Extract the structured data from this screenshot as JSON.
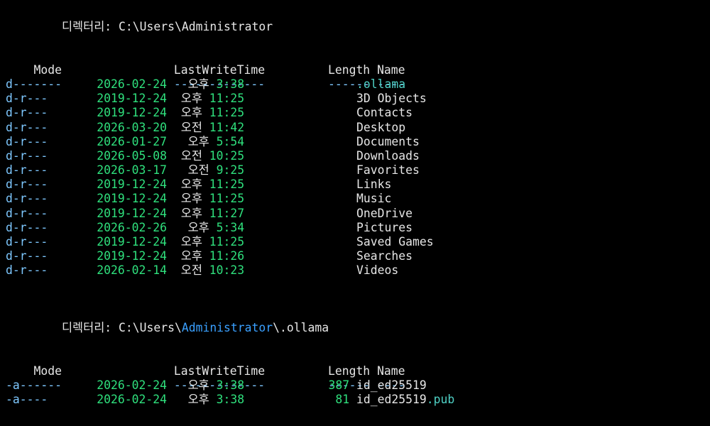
{
  "colors": {
    "background": "#000000",
    "foreground": "#e6e6e6",
    "underline": "#7ec8ff",
    "path_highlight": "#3aa0ff",
    "timestamp": "#2fe07d",
    "file_accent": "#4fd1c5"
  },
  "listings": [
    {
      "dir_label": "디렉터리:",
      "dir_path": "C:\\Users\\Administrator",
      "dir_path_parts": {
        "prefix": "C:\\Users\\",
        "highlight": "",
        "suffix": "Administrator"
      },
      "headers": {
        "mode": "Mode",
        "lastwritetime": "LastWriteTime",
        "length": "Length",
        "name": "Name"
      },
      "underlines": {
        "mode": "----",
        "lastwritetime": "-------------",
        "length": "------",
        "name": "----"
      },
      "rows": [
        {
          "mode": "d-----",
          "date": "2026-02-24",
          "ampm": "오후",
          "time": "3:38",
          "length": "",
          "name": ".ollama",
          "name_accent": true
        },
        {
          "mode": "d-r---",
          "date": "2019-12-24",
          "ampm": "오후",
          "time": "11:25",
          "length": "",
          "name": "3D Objects"
        },
        {
          "mode": "d-r---",
          "date": "2019-12-24",
          "ampm": "오후",
          "time": "11:25",
          "length": "",
          "name": "Contacts"
        },
        {
          "mode": "d-r---",
          "date": "2026-03-20",
          "ampm": "오전",
          "time": "11:42",
          "length": "",
          "name": "Desktop"
        },
        {
          "mode": "d-r---",
          "date": "2026-01-27",
          "ampm": "오후",
          "time": "5:54",
          "length": "",
          "name": "Documents"
        },
        {
          "mode": "d-r---",
          "date": "2026-05-08",
          "ampm": "오전",
          "time": "10:25",
          "length": "",
          "name": "Downloads"
        },
        {
          "mode": "d-r---",
          "date": "2026-03-17",
          "ampm": "오전",
          "time": "9:25",
          "length": "",
          "name": "Favorites"
        },
        {
          "mode": "d-r---",
          "date": "2019-12-24",
          "ampm": "오후",
          "time": "11:25",
          "length": "",
          "name": "Links"
        },
        {
          "mode": "d-r---",
          "date": "2019-12-24",
          "ampm": "오후",
          "time": "11:25",
          "length": "",
          "name": "Music"
        },
        {
          "mode": "d-r---",
          "date": "2019-12-24",
          "ampm": "오후",
          "time": "11:27",
          "length": "",
          "name": "OneDrive"
        },
        {
          "mode": "d-r---",
          "date": "2026-02-26",
          "ampm": "오후",
          "time": "5:34",
          "length": "",
          "name": "Pictures"
        },
        {
          "mode": "d-r---",
          "date": "2019-12-24",
          "ampm": "오후",
          "time": "11:25",
          "length": "",
          "name": "Saved Games"
        },
        {
          "mode": "d-r---",
          "date": "2019-12-24",
          "ampm": "오후",
          "time": "11:26",
          "length": "",
          "name": "Searches"
        },
        {
          "mode": "d-r---",
          "date": "2026-02-14",
          "ampm": "오전",
          "time": "10:23",
          "length": "",
          "name": "Videos"
        }
      ]
    },
    {
      "dir_label": "디렉터리:",
      "dir_path": "C:\\Users\\Administrator\\.ollama",
      "dir_path_parts": {
        "prefix": "C:\\Users\\",
        "highlight": "Administrator",
        "suffix": "\\.ollama"
      },
      "headers": {
        "mode": "Mode",
        "lastwritetime": "LastWriteTime",
        "length": "Length",
        "name": "Name"
      },
      "underlines": {
        "mode": "----",
        "lastwritetime": "-------------",
        "length": "------",
        "name": "----"
      },
      "rows": [
        {
          "mode": "-a----",
          "date": "2026-02-24",
          "ampm": "오후",
          "time": "3:38",
          "length": "387",
          "name": "id_ed25519"
        },
        {
          "mode": "-a----",
          "date": "2026-02-24",
          "ampm": "오후",
          "time": "3:38",
          "length": "81",
          "name": "id_ed25519.pub",
          "name_split": {
            "base": "id_ed25519",
            "ext": ".pub"
          }
        }
      ]
    }
  ]
}
